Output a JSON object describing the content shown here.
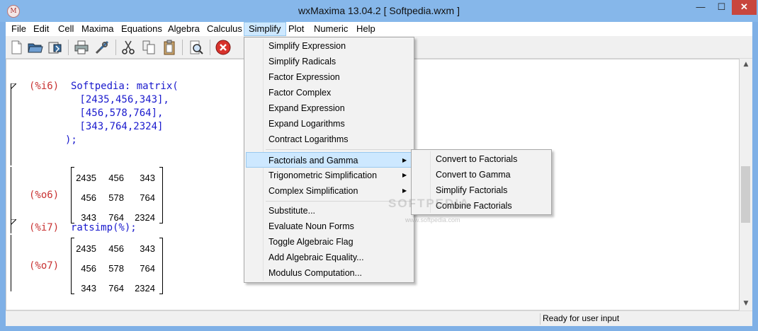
{
  "window": {
    "title": "wxMaxima 13.04.2  [ Softpedia.wxm ]",
    "minimize_glyph": "—",
    "maximize_glyph": "☐",
    "close_glyph": "✕",
    "app_icon_glyph": "M"
  },
  "menubar": [
    "File",
    "Edit",
    "Cell",
    "Maxima",
    "Equations",
    "Algebra",
    "Calculus",
    "Simplify",
    "Plot",
    "Numeric",
    "Help"
  ],
  "toolbar_icons": [
    "new-file-icon",
    "open-folder-icon",
    "save-icon",
    "print-icon",
    "preferences-icon",
    "cut-icon",
    "copy-icon",
    "paste-icon",
    "find-icon",
    "interrupt-icon"
  ],
  "cells": {
    "i6": {
      "label": "(%i6)",
      "lines": [
        "Softpedia: matrix(",
        " [2435,456,343],",
        " [456,578,764],",
        " [343,764,2324]",
        ");"
      ]
    },
    "o6": {
      "label": "(%o6)",
      "rows": [
        [
          "2435",
          "456",
          "343"
        ],
        [
          "456",
          "578",
          "764"
        ],
        [
          "343",
          "764",
          "2324"
        ]
      ]
    },
    "i7": {
      "label": "(%i7)",
      "code": "ratsimp(%);"
    },
    "o7": {
      "label": "(%o7)",
      "rows": [
        [
          "2435",
          "456",
          "343"
        ],
        [
          "456",
          "578",
          "764"
        ],
        [
          "343",
          "764",
          "2324"
        ]
      ]
    }
  },
  "simplify_menu": {
    "group1": [
      "Simplify Expression",
      "Simplify Radicals",
      "Factor Expression",
      "Factor Complex",
      "Expand Expression",
      "Expand Logarithms",
      "Contract Logarithms"
    ],
    "group2": [
      "Factorials and Gamma",
      "Trigonometric Simplification",
      "Complex Simplification"
    ],
    "group3": [
      "Substitute...",
      "Evaluate Noun Forms",
      "Toggle Algebraic Flag",
      "Add Algebraic Equality...",
      "Modulus Computation..."
    ],
    "submenu_arrow": "▶"
  },
  "factorials_submenu": [
    "Convert to Factorials",
    "Convert to Gamma",
    "Simplify Factorials",
    "Combine Factorials"
  ],
  "status": {
    "text": "Ready for user input"
  },
  "scrollbar": {
    "up_arrow": "▲",
    "down_arrow": "▼"
  },
  "watermark": {
    "text": "SOFTPEDIA",
    "url": "www.softpedia.com"
  }
}
